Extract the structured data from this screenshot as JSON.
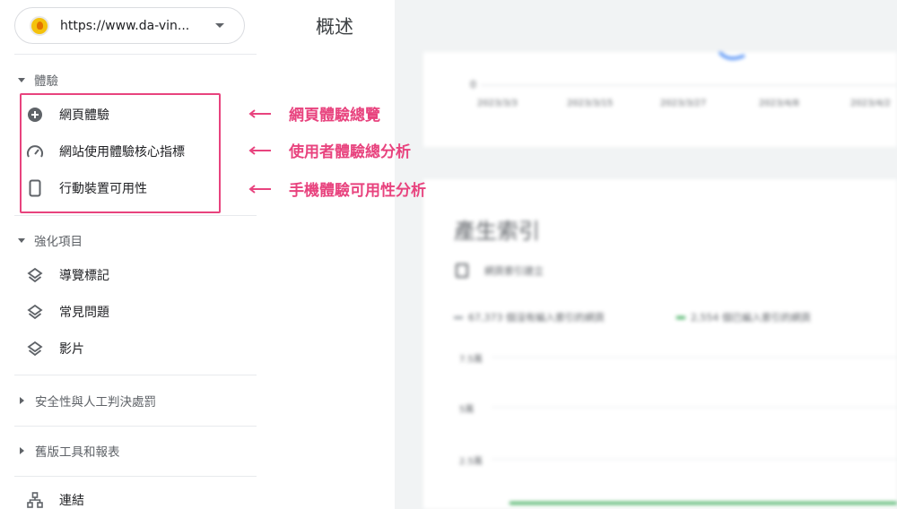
{
  "property": {
    "url": "https://www.da-vin..."
  },
  "header": {
    "title": "概述"
  },
  "sections": {
    "experience": "體驗",
    "enhancements": "強化項目",
    "security": "安全性與人工判決處罰",
    "legacy": "舊版工具和報表"
  },
  "experience_items": [
    {
      "label": "網頁體驗",
      "icon": "plus-circle-icon"
    },
    {
      "label": "網站使用體驗核心指標",
      "icon": "speedometer-icon"
    },
    {
      "label": "行動裝置可用性",
      "icon": "phone-icon"
    }
  ],
  "enhancement_items": [
    {
      "label": "導覽標記",
      "icon": "layers-icon"
    },
    {
      "label": "常見問題",
      "icon": "layers-icon"
    },
    {
      "label": "影片",
      "icon": "layers-icon"
    }
  ],
  "links_item": {
    "label": "連結",
    "icon": "sitemap-icon"
  },
  "annotations": [
    "網頁體驗總覽",
    "使用者體驗總分析",
    "手機體驗可用性分析"
  ],
  "colors": {
    "annotation": "#e8437e",
    "chart_green": "#34a853",
    "chart_gray": "#9aa0a6"
  },
  "blurred_main": {
    "top_chart": {
      "y_zero": "0",
      "dates": [
        "2023/3/3",
        "2023/3/15",
        "2023/3/27",
        "2023/4/8",
        "2023/4/2"
      ]
    },
    "card_title": "產生索引",
    "card_subtitle": "網頁索引建立",
    "legend": [
      "67,373 個沒有編入索引的網頁",
      "2,554 個已編入索引的網頁"
    ],
    "yticks": [
      "7.5萬",
      "5萬",
      "2.5萬"
    ]
  }
}
